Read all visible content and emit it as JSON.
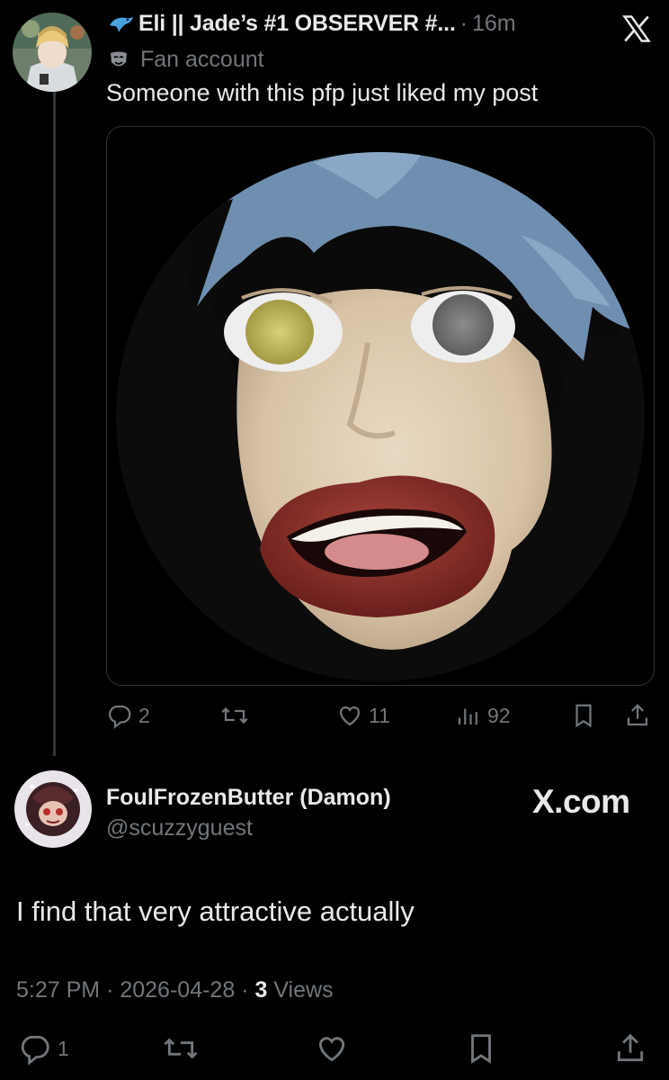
{
  "post": {
    "display_name": "Eli || Jade’s #1 OBSERVER #...",
    "time": "16m",
    "label": "Fan account",
    "text": "Someone with this pfp just liked my post",
    "stats": {
      "replies": "2",
      "likes": "11",
      "views": "92"
    }
  },
  "reply": {
    "display_name": "FoulFrozenButter (Damon)",
    "handle": "@scuzzyguest",
    "watermark": "X.com",
    "text": "I find that very attractive actually",
    "time": "5:27 PM",
    "date": "2026-04-28",
    "views_count": "3",
    "views_label": "Views",
    "replies": "1"
  },
  "colors": {
    "background": "#000000",
    "primary_text": "#e7e9ea",
    "secondary_text": "#71767b",
    "divider": "#2f3336"
  },
  "icons": [
    "dolphin-emoji-icon",
    "mask-emoji-icon",
    "x-logo-icon",
    "reply-icon",
    "retweet-icon",
    "like-icon",
    "views-icon",
    "bookmark-icon",
    "share-icon"
  ]
}
